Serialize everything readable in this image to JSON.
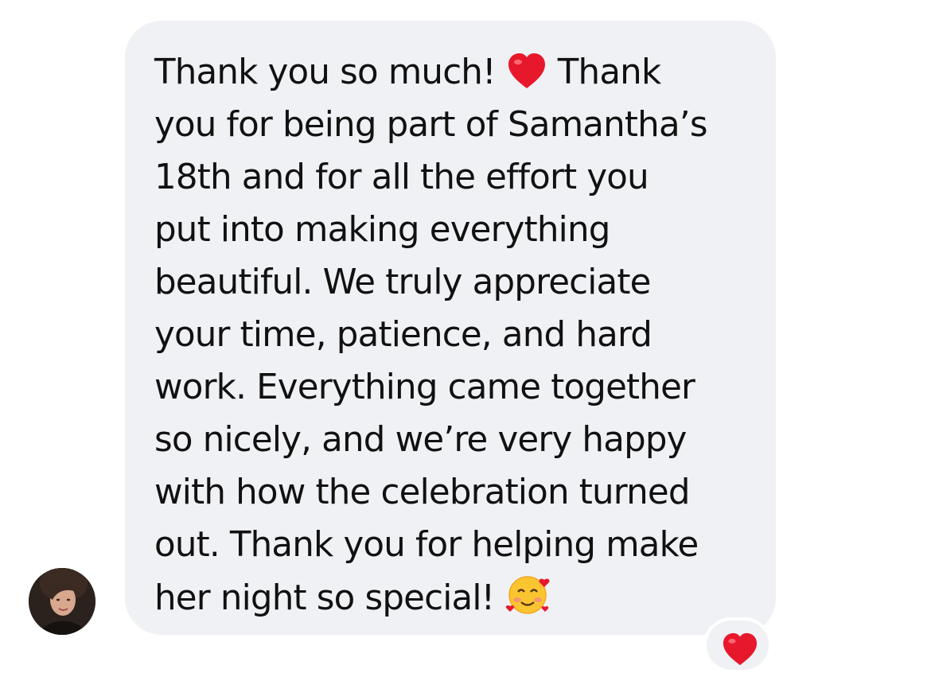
{
  "conversation": {
    "message": {
      "lines": [
        "Thank you so much!",
        "Thank",
        "you for being part of Samantha’s",
        "18th and for all the effort you",
        "put into making everything",
        "beautiful. We truly appreciate",
        "your time, patience, and hard",
        "work. Everything came together",
        "so nicely, and we’re very happy",
        "with how the celebration turned",
        "out. Thank you for helping make",
        "her night so special!"
      ],
      "emojis": [
        "red-heart",
        "smiling-face-with-hearts"
      ]
    },
    "reaction": {
      "emoji": "red-heart"
    }
  },
  "colors": {
    "bubble": "#f0f1f5",
    "text": "#111111",
    "heart": "#e8182c"
  }
}
